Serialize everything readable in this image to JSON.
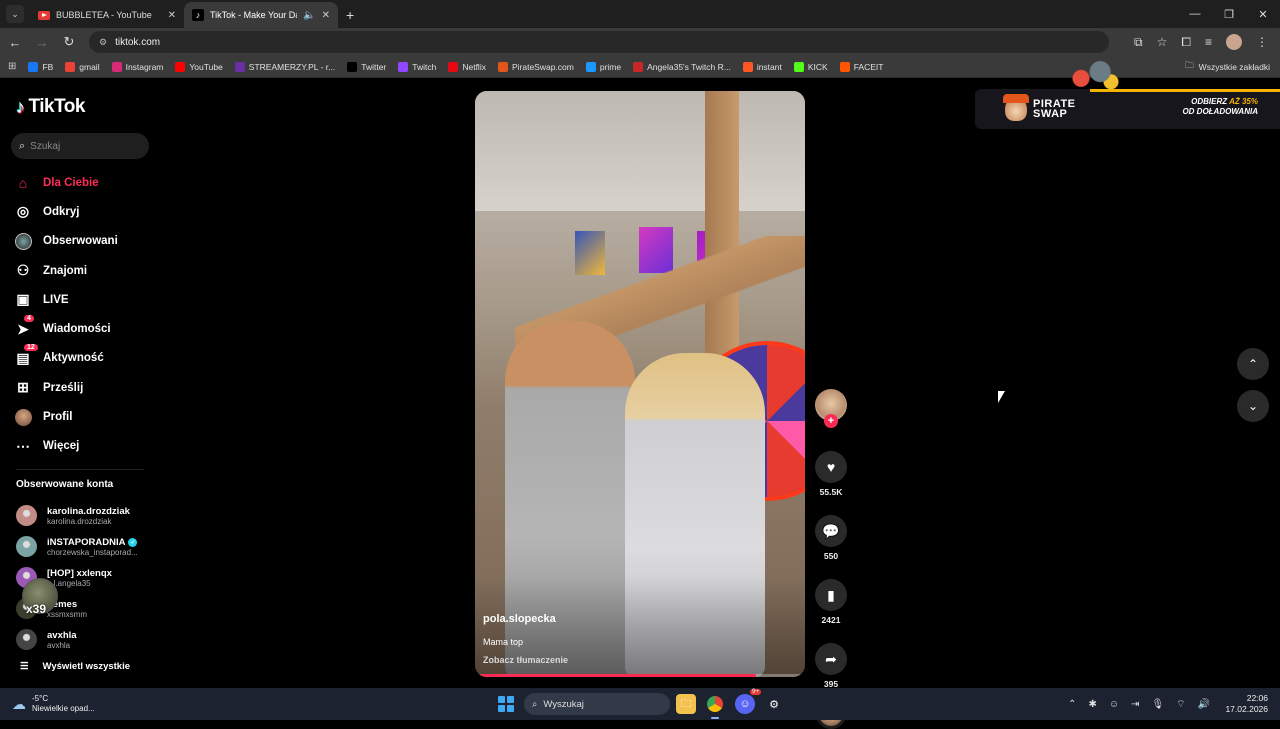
{
  "browser": {
    "tabs": [
      {
        "title": "BUBBLETEA - YouTube",
        "favicon": "youtube-icon",
        "active": false
      },
      {
        "title": "TikTok - Make Your Day",
        "favicon": "tiktok-icon",
        "active": true
      }
    ],
    "url": "tiktok.com",
    "bookmarks": [
      {
        "label": "FB",
        "icon_color": "#1877f2"
      },
      {
        "label": "gmail",
        "icon_color": "#ea4335"
      },
      {
        "label": "Instagram",
        "icon_color": "#d62976"
      },
      {
        "label": "YouTube",
        "icon_color": "#ff0000"
      },
      {
        "label": "STREAMERZY.PL - r...",
        "icon_color": "#6b2fa3"
      },
      {
        "label": "Twitter",
        "icon_color": "#000000"
      },
      {
        "label": "Twitch",
        "icon_color": "#9146ff"
      },
      {
        "label": "Netflix",
        "icon_color": "#e50914"
      },
      {
        "label": "PirateSwap.com",
        "icon_color": "#e2551b"
      },
      {
        "label": "prime",
        "icon_color": "#1a98ff"
      },
      {
        "label": "Angela35's Twitch R...",
        "icon_color": "#c62828"
      },
      {
        "label": "instant",
        "icon_color": "#ff5722"
      },
      {
        "label": "KICK",
        "icon_color": "#53fc18"
      },
      {
        "label": "FACEIT",
        "icon_color": "#ff5500"
      }
    ],
    "all_bookmarks": "Wszystkie zakładki"
  },
  "tiktok": {
    "logo": "TikTok",
    "search_placeholder": "Szukaj",
    "nav": [
      {
        "label": "Dla Ciebie",
        "icon": "home-icon",
        "active": true
      },
      {
        "label": "Odkryj",
        "icon": "compass-icon"
      },
      {
        "label": "Obserwowani",
        "icon": "following-avatar-icon"
      },
      {
        "label": "Znajomi",
        "icon": "friends-icon"
      },
      {
        "label": "LIVE",
        "icon": "live-icon"
      },
      {
        "label": "Wiadomości",
        "icon": "messages-icon",
        "badge": "4"
      },
      {
        "label": "Aktywność",
        "icon": "activity-icon",
        "badge": "12"
      },
      {
        "label": "Prześlij",
        "icon": "upload-icon"
      },
      {
        "label": "Profil",
        "icon": "profile-avatar-icon"
      },
      {
        "label": "Więcej",
        "icon": "more-icon"
      }
    ],
    "followed_title": "Obserwowane konta",
    "accounts": [
      {
        "name": "karolina.drozdziak",
        "user": "karolina.drozdziak",
        "verified": false,
        "color": "#c38b86"
      },
      {
        "name": "iNSTAPORADNIA",
        "user": "chorzewska_instaporad...",
        "verified": true,
        "color": "#7ba3a3"
      },
      {
        "name": "[HOP] xxlenqx",
        "user": "...l.angela35",
        "verified": false,
        "color": "#9b59b6"
      },
      {
        "name": "nemes",
        "user": "xssmxsmm",
        "verified": false,
        "color": "#3b3d2c"
      },
      {
        "name": "avxhla",
        "user": "avxhla",
        "verified": false,
        "color": "#444444"
      }
    ],
    "see_all": "Wyświetl wszystkie",
    "overlay_number": "x39",
    "video": {
      "author": "pola.slopecka",
      "caption": "Mama top",
      "translate": "Zobacz tłumaczenie",
      "progress": 0.85
    },
    "actions": {
      "likes": "55.5K",
      "comments": "550",
      "saves": "2421",
      "shares": "395"
    },
    "ad": {
      "brand_line1": "PIRATE",
      "brand_line2": "SWAP",
      "offer_line1_prefix": "ODBIERZ ",
      "offer_line1_highlight": "AŻ 35%",
      "offer_line2": "OD DOŁADOWANIA"
    }
  },
  "taskbar": {
    "weather_temp": "-5°C",
    "weather_desc": "Niewielkie opad...",
    "search": "Wyszukaj",
    "time": "22:06",
    "date": "17.02.2026",
    "discord_badge": "9+"
  }
}
